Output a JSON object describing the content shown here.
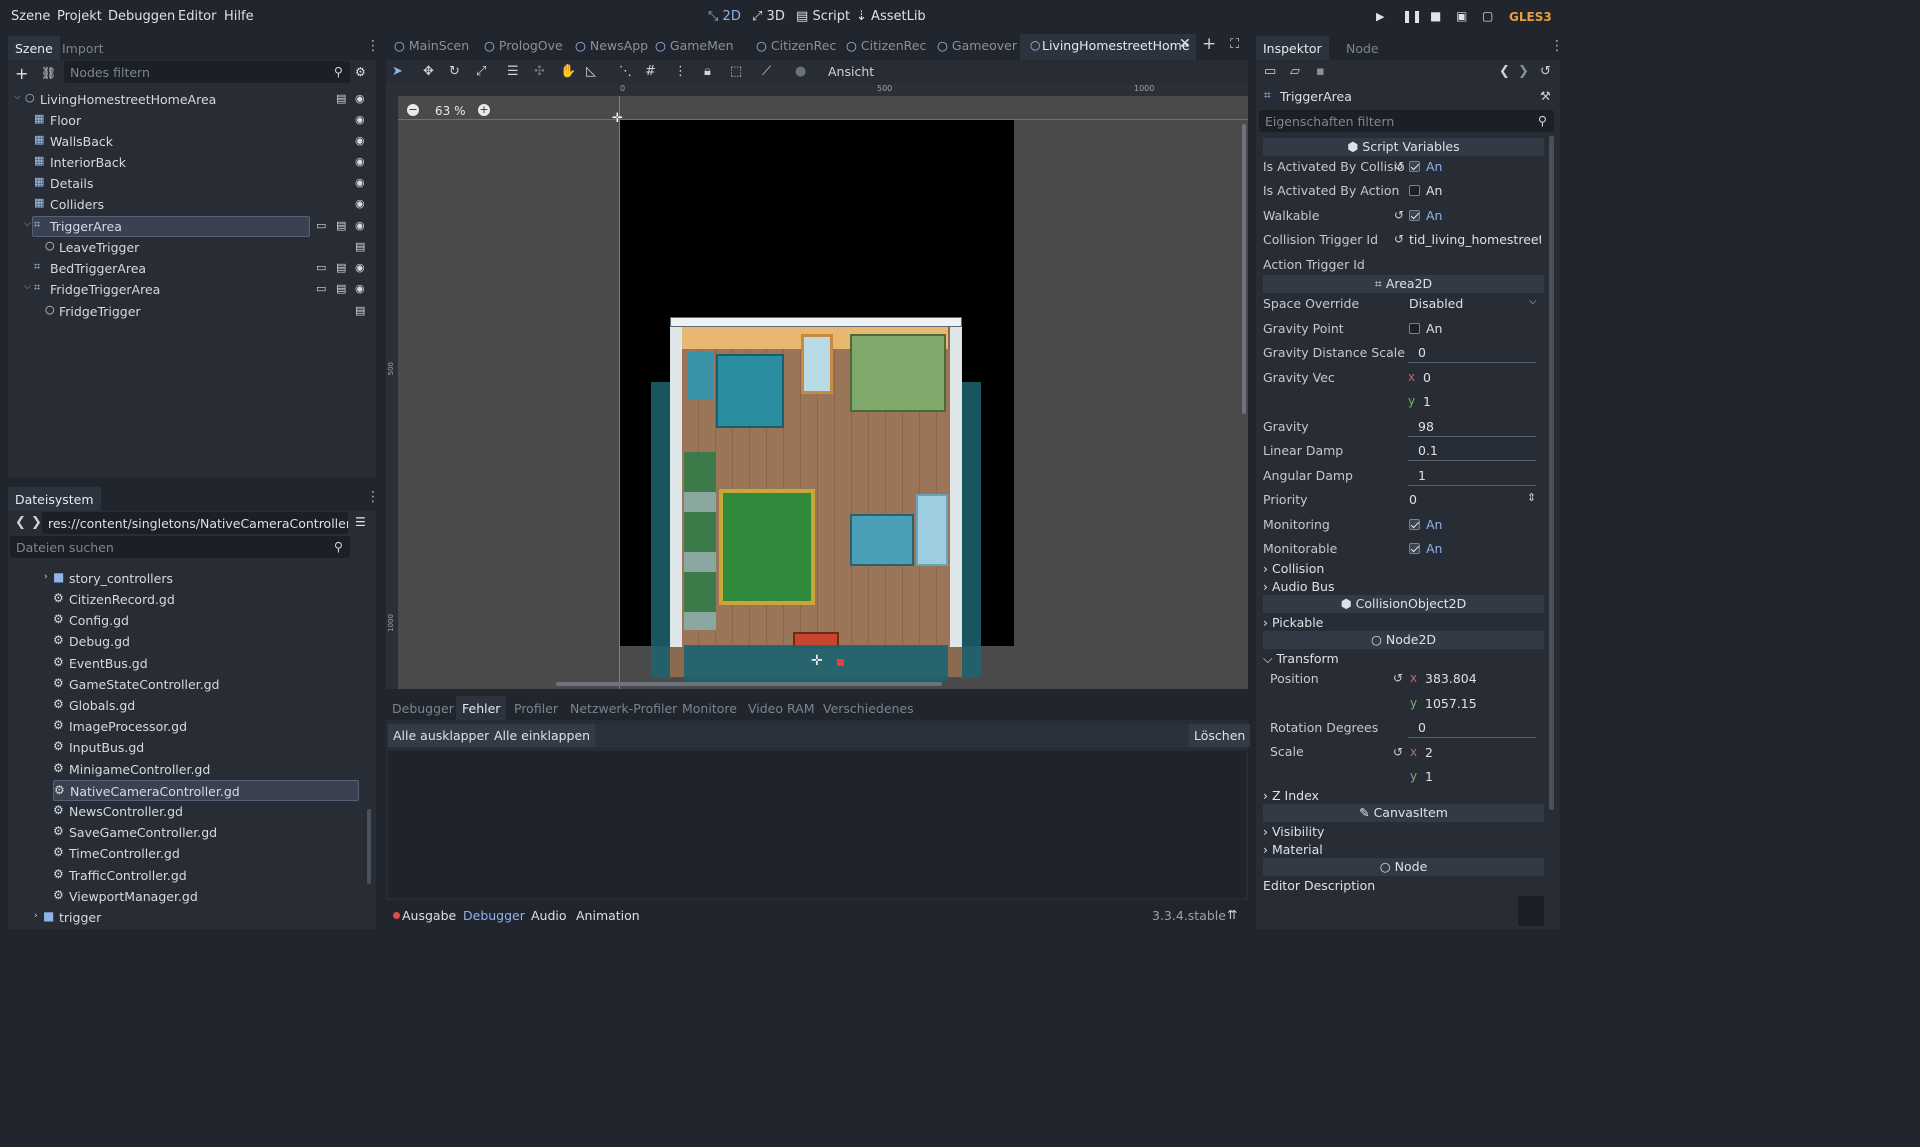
{
  "menu": [
    "Szene",
    "Projekt",
    "Debuggen",
    "Editor",
    "Hilfe"
  ],
  "workspaces": [
    {
      "label": "2D",
      "icon": "2d-icon"
    },
    {
      "label": "3D",
      "icon": "3d-icon"
    },
    {
      "label": "Script",
      "icon": "script-icon"
    },
    {
      "label": "AssetLib",
      "icon": "assetlib-icon"
    }
  ],
  "renderer": "GLES3",
  "scene_panel": {
    "tab_active": "Szene",
    "tab_inactive": "Import",
    "filter_placeholder": "Nodes filtern",
    "nodes": [
      {
        "label": "LivingHomestreetHomeArea",
        "icon": "node2d-icon"
      },
      {
        "label": "Floor",
        "icon": "tilemap-icon"
      },
      {
        "label": "WallsBack",
        "icon": "tilemap-icon"
      },
      {
        "label": "InteriorBack",
        "icon": "tilemap-icon"
      },
      {
        "label": "Details",
        "icon": "tilemap-icon"
      },
      {
        "label": "Colliders",
        "icon": "tilemap-icon"
      },
      {
        "label": "TriggerArea",
        "icon": "area2d-icon"
      },
      {
        "label": "LeaveTrigger",
        "icon": "node2d-icon"
      },
      {
        "label": "BedTriggerArea",
        "icon": "area2d-icon"
      },
      {
        "label": "FridgeTriggerArea",
        "icon": "area2d-icon"
      },
      {
        "label": "FridgeTrigger",
        "icon": "node2d-icon"
      }
    ]
  },
  "filesystem": {
    "tab": "Dateisystem",
    "path": "res://content/singletons/NativeCameraController.gd",
    "search_placeholder": "Dateien suchen",
    "folder_top": "story_controllers",
    "files": [
      "CitizenRecord.gd",
      "Config.gd",
      "Debug.gd",
      "EventBus.gd",
      "GameStateController.gd",
      "Globals.gd",
      "ImageProcessor.gd",
      "InputBus.gd",
      "MinigameController.gd",
      "NativeCameraController.gd",
      "NewsController.gd",
      "SaveGameController.gd",
      "TimeController.gd",
      "TrafficController.gd",
      "ViewportManager.gd"
    ],
    "folder_bottom": "trigger"
  },
  "editor_tabs": [
    "MainScen",
    "PrologOve",
    "NewsApp",
    "GameMen",
    "CitizenRec",
    "CitizenRec",
    "Gameover",
    "LivingHomestreetHome"
  ],
  "toolbar": {
    "view_label": "Ansicht"
  },
  "viewport": {
    "zoom": "63 %",
    "ruler": [
      "0",
      "500",
      "1000"
    ],
    "ruler_v": [
      "500",
      "1000"
    ]
  },
  "bottom": {
    "tabs": [
      "Debugger",
      "Fehler",
      "Profiler",
      "Netzwerk-Profiler",
      "Monitore",
      "Video RAM",
      "Verschiedenes"
    ],
    "expand": "Alle ausklappen",
    "collapse": "Alle einklappen",
    "clear": "Löschen",
    "status_tabs": [
      "Ausgabe",
      "Debugger",
      "Audio",
      "Animation"
    ],
    "version": "3.3.4.stable"
  },
  "inspector": {
    "tab_active": "Inspektor",
    "tab_inactive": "Node",
    "node": "TriggerArea",
    "filter_placeholder": "Eigenschaften filtern",
    "sec_script": "Script Variables",
    "is_activated_collision": "Is Activated By Collisio",
    "is_activated_action": "Is Activated By Action",
    "walkable": "Walkable",
    "collision_trigger_id": "Collision Trigger Id",
    "collision_trigger_val": "tid_living_homestreet_h",
    "action_trigger_id": "Action Trigger Id",
    "on": "An",
    "sec_area": "Area2D",
    "space_override": "Space Override",
    "space_override_val": "Disabled",
    "gravity_point": "Gravity Point",
    "gravity_distance": "Gravity Distance Scale",
    "gravity_distance_val": "0",
    "gravity_vec": "Gravity Vec",
    "gv_x": "0",
    "gv_y": "1",
    "gravity": "Gravity",
    "gravity_val": "98",
    "linear_damp": "Linear Damp",
    "linear_damp_val": "0.1",
    "angular_damp": "Angular Damp",
    "angular_damp_val": "1",
    "priority": "Priority",
    "priority_val": "0",
    "monitoring": "Monitoring",
    "monitorable": "Monitorable",
    "collision": "Collision",
    "audio_bus": "Audio Bus",
    "sec_co": "CollisionObject2D",
    "pickable": "Pickable",
    "sec_n2d": "Node2D",
    "transform": "Transform",
    "position": "Position",
    "pos_x": "383.804",
    "pos_y": "1057.15",
    "rotation": "Rotation Degrees",
    "rotation_val": "0",
    "scale": "Scale",
    "scale_x": "2",
    "scale_y": "1",
    "z_index": "Z Index",
    "sec_canvas": "CanvasItem",
    "visibility": "Visibility",
    "material": "Material",
    "sec_node": "Node",
    "editor_desc": "Editor Description",
    "axis_x": "x",
    "axis_y": "y"
  }
}
